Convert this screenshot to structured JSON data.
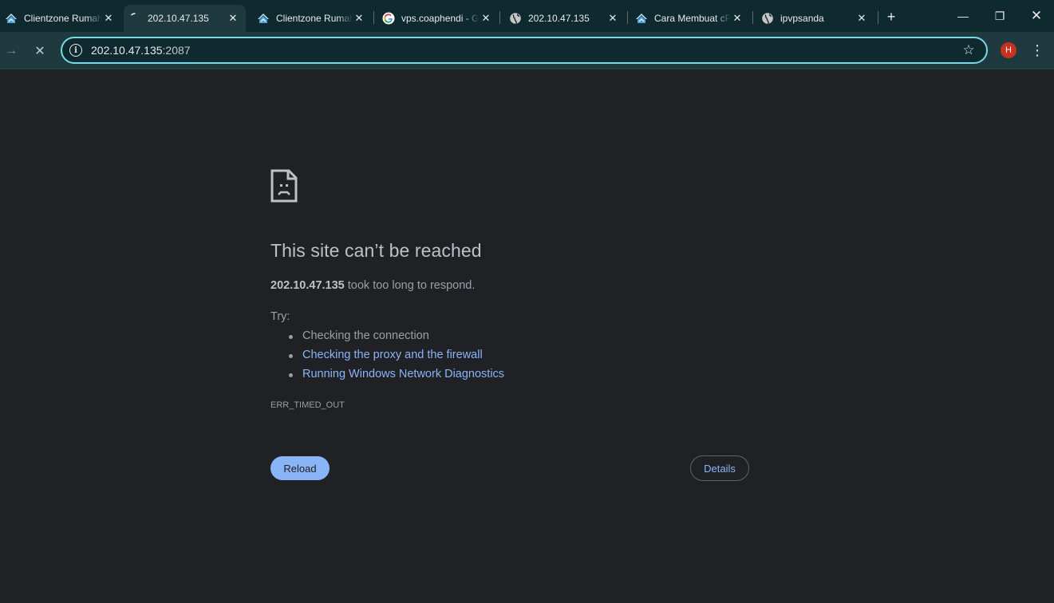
{
  "tabs": [
    {
      "title": "Clientzone Rumahweb",
      "favicon": "rumahweb-icon",
      "active": false
    },
    {
      "title": "202.10.47.135",
      "favicon": "loading-icon",
      "active": true
    },
    {
      "title": "Clientzone Rumahweb",
      "favicon": "rumahweb-icon",
      "active": false
    },
    {
      "title": "vps.coaphendi - Google",
      "favicon": "google-icon",
      "active": false
    },
    {
      "title": "202.10.47.135",
      "favicon": "globe-icon",
      "active": false
    },
    {
      "title": "Cara Membuat cPanel",
      "favicon": "rumahweb-icon",
      "active": false
    },
    {
      "title": "ipvpsanda",
      "favicon": "globe-icon",
      "active": false
    }
  ],
  "tab_close_glyph": "✕",
  "new_tab_glyph": "+",
  "window_controls": {
    "minimize": "—",
    "restore": "❐",
    "close": "✕"
  },
  "toolbar": {
    "forward_glyph": "→",
    "stop_glyph": "✕",
    "url_host": "202.10.47.135",
    "url_port": ":2087",
    "info_glyph": "i",
    "bookmark_glyph": "☆",
    "avatar_letter": "H",
    "menu_glyph": "⋮"
  },
  "error": {
    "title": "This site can’t be reached",
    "host": "202.10.47.135",
    "description": " took too long to respond.",
    "try_label": "Try:",
    "suggestions": [
      {
        "text": "Checking the connection",
        "link": false
      },
      {
        "text": "Checking the proxy and the firewall",
        "link": true
      },
      {
        "text": "Running Windows Network Diagnostics",
        "link": true
      }
    ],
    "code": "ERR_TIMED_OUT",
    "reload_label": "Reload",
    "details_label": "Details"
  },
  "colors": {
    "page_bg": "#202124",
    "titlebar_bg": "#0f2a2f",
    "toolbar_bg": "#1f3a3f",
    "omnibox_border": "#78d9e6",
    "link": "#8ab4f8",
    "avatar": "#c5321d"
  }
}
